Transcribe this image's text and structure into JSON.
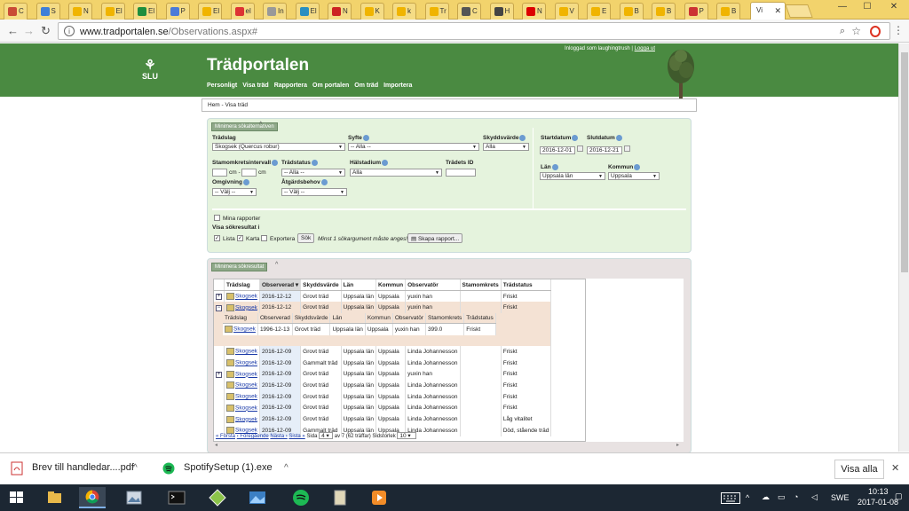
{
  "browser": {
    "tabs": [
      {
        "title": "C",
        "color": "#c94b36"
      },
      {
        "title": "S",
        "color": "#3f7fd8"
      },
      {
        "title": "N",
        "color": "#f0b400"
      },
      {
        "title": "El",
        "color": "#f0b400"
      },
      {
        "title": "El",
        "color": "#1e8e3e"
      },
      {
        "title": "P",
        "color": "#4b7bd8"
      },
      {
        "title": "El",
        "color": "#f0b400"
      },
      {
        "title": "el",
        "color": "#d33"
      },
      {
        "title": "In",
        "color": "#999"
      },
      {
        "title": "El",
        "color": "#2a8fc1"
      },
      {
        "title": "N",
        "color": "#c22"
      },
      {
        "title": "K",
        "color": "#f0b400"
      },
      {
        "title": "k",
        "color": "#f0b400"
      },
      {
        "title": "Tr",
        "color": "#f0b400"
      },
      {
        "title": "C",
        "color": "#555"
      },
      {
        "title": "H",
        "color": "#444"
      },
      {
        "title": "N",
        "color": "#d00"
      },
      {
        "title": "V",
        "color": "#f0b400"
      },
      {
        "title": "E",
        "color": "#f0b400"
      },
      {
        "title": "B",
        "color": "#f0b400"
      },
      {
        "title": "B",
        "color": "#f0b400"
      },
      {
        "title": "P",
        "color": "#c33"
      },
      {
        "title": "B",
        "color": "#f0b400"
      }
    ],
    "active_tab": "Vi",
    "url_host": "www.tradportalen.se",
    "url_path": "/Observations.aspx#"
  },
  "site": {
    "logo": "SLU",
    "title": "Trädportalen",
    "nav": [
      "Personligt",
      "Visa träd",
      "Rapportera",
      "Om portalen",
      "Om träd",
      "Importera"
    ],
    "login_text": "Inloggad som laughingtrush |",
    "logout": "Logga ut",
    "breadcrumb": "Hem - Visa träd"
  },
  "search": {
    "header": "Minimera sökalternativen",
    "tradslag_label": "Trädslag",
    "tradslag_value": "Skogsek (Quercus robur)",
    "syfte_label": "Syfte",
    "syfte_value": "-- Alla --",
    "skyddsvarde_label": "Skyddsvärde",
    "skyddsvarde_value": "Alla",
    "startdatum_label": "Startdatum",
    "startdatum_value": "2016-12-01",
    "slutdatum_label": "Slutdatum",
    "slutdatum_value": "2016-12-21",
    "stamomkrets_label": "Stamomkretsintervall",
    "cm1": "cm -",
    "cm2": "cm",
    "tradstatus_label": "Trädstatus",
    "tradstatus_value": "-- Alla --",
    "halstadium_label": "Hälstadium",
    "halstadium_value": "Alla",
    "tradets_id_label": "Trädets ID",
    "lan_label": "Län",
    "lan_value": "Uppsala län",
    "kommun_label": "Kommun",
    "kommun_value": "Uppsala",
    "omgivning_label": "Omgivning",
    "omgivning_value": "-- Välj --",
    "atgardsbehov_label": "Åtgärdsbehov",
    "atgardsbehov_value": "-- Välj --",
    "mina_rapporter": "Mina rapporter",
    "visa_sokresultat": "Visa sökresultat i",
    "lista": "Lista",
    "karta": "Karta",
    "exportera": "Exportera",
    "sok_button": "Sök",
    "min_note": "Minst 1 sökargument måste anges!",
    "skapa_rapport": "Skapa rapport..."
  },
  "results": {
    "header": "Minimera sökresultat",
    "columns": [
      "Trädslag",
      "Observerad",
      "Skyddsvärde",
      "Län",
      "Kommun",
      "Observatör",
      "Stamomkrets",
      "Trädstatus"
    ],
    "rows_top": [
      {
        "exp": "+",
        "tradslag": "Skogsek",
        "observerad": "2016-12-12",
        "skyddsvarde": "Grovt träd",
        "lan": "Uppsala län",
        "kommun": "Uppsala",
        "observator": "yuxin han",
        "stamomkrets": "",
        "tradstatus": "Friskt"
      },
      {
        "exp": "−",
        "tradslag": "Skogsek",
        "observerad": "2016-12-12",
        "skyddsvarde": "Grovt träd",
        "lan": "Uppsala län",
        "kommun": "Uppsala",
        "observator": "yuxin han",
        "stamomkrets": "",
        "tradstatus": "Friskt"
      }
    ],
    "sub_columns": [
      "Trädslag",
      "Observerad",
      "Skyddsvärde",
      "Län",
      "Kommun",
      "Observatör",
      "Stamomkrets",
      "Trädstatus"
    ],
    "sub_row": {
      "tradslag": "Skogsek",
      "observerad": "1996-12-13",
      "skyddsvarde": "Grovt träd",
      "lan": "Uppsala län",
      "kommun": "Uppsala",
      "observator": "yuxin han",
      "stamomkrets": "399.0",
      "tradstatus": "Friskt"
    },
    "rows_bottom": [
      {
        "exp": "",
        "tradslag": "Skogsek",
        "observerad": "2016-12-09",
        "skyddsvarde": "Grovt träd",
        "lan": "Uppsala län",
        "kommun": "Uppsala",
        "observator": "Linda Johannesson",
        "stamomkrets": "",
        "tradstatus": "Friskt"
      },
      {
        "exp": "",
        "tradslag": "Skogsek",
        "observerad": "2016-12-09",
        "skyddsvarde": "Gammalt träd",
        "lan": "Uppsala län",
        "kommun": "Uppsala",
        "observator": "Linda Johannesson",
        "stamomkrets": "",
        "tradstatus": "Friskt"
      },
      {
        "exp": "+",
        "tradslag": "Skogsek",
        "observerad": "2016-12-09",
        "skyddsvarde": "Grovt träd",
        "lan": "Uppsala län",
        "kommun": "Uppsala",
        "observator": "yuxin han",
        "stamomkrets": "",
        "tradstatus": "Friskt"
      },
      {
        "exp": "",
        "tradslag": "Skogsek",
        "observerad": "2016-12-09",
        "skyddsvarde": "Grovt träd",
        "lan": "Uppsala län",
        "kommun": "Uppsala",
        "observator": "Linda Johannesson",
        "stamomkrets": "",
        "tradstatus": "Friskt"
      },
      {
        "exp": "",
        "tradslag": "Skogsek",
        "observerad": "2016-12-09",
        "skyddsvarde": "Grovt träd",
        "lan": "Uppsala län",
        "kommun": "Uppsala",
        "observator": "Linda Johannesson",
        "stamomkrets": "",
        "tradstatus": "Friskt"
      },
      {
        "exp": "",
        "tradslag": "Skogsek",
        "observerad": "2016-12-09",
        "skyddsvarde": "Grovt träd",
        "lan": "Uppsala län",
        "kommun": "Uppsala",
        "observator": "Linda Johannesson",
        "stamomkrets": "",
        "tradstatus": "Friskt"
      },
      {
        "exp": "",
        "tradslag": "Skogsek",
        "observerad": "2016-12-09",
        "skyddsvarde": "Grovt träd",
        "lan": "Uppsala län",
        "kommun": "Uppsala",
        "observator": "Linda Johannesson",
        "stamomkrets": "",
        "tradstatus": "Låg vitalitet"
      },
      {
        "exp": "",
        "tradslag": "Skogsek",
        "observerad": "2016-12-09",
        "skyddsvarde": "Gammalt träd",
        "lan": "Uppsala län",
        "kommun": "Uppsala",
        "observator": "Linda Johannesson",
        "stamomkrets": "",
        "tradstatus": "Död, stående träd"
      }
    ],
    "pager": {
      "first": "« Första",
      "prev": "‹ Föregående",
      "next": "Nästa ›",
      "last": "Sista »",
      "sida_label": "Sida",
      "page": "4",
      "of_text": "av 7 (62 träffar)",
      "sidstorlek_label": "Sidstorlek",
      "page_size": "10"
    }
  },
  "downloads": [
    {
      "name": "Brev till handledar....pdf",
      "icon": "pdf-icon"
    },
    {
      "name": "SpotifySetup (1).exe",
      "icon": "spotify-icon"
    }
  ],
  "show_all": "Visa alla",
  "taskbar": {
    "lang": "SWE",
    "time": "10:13",
    "date": "2017-01-08"
  }
}
